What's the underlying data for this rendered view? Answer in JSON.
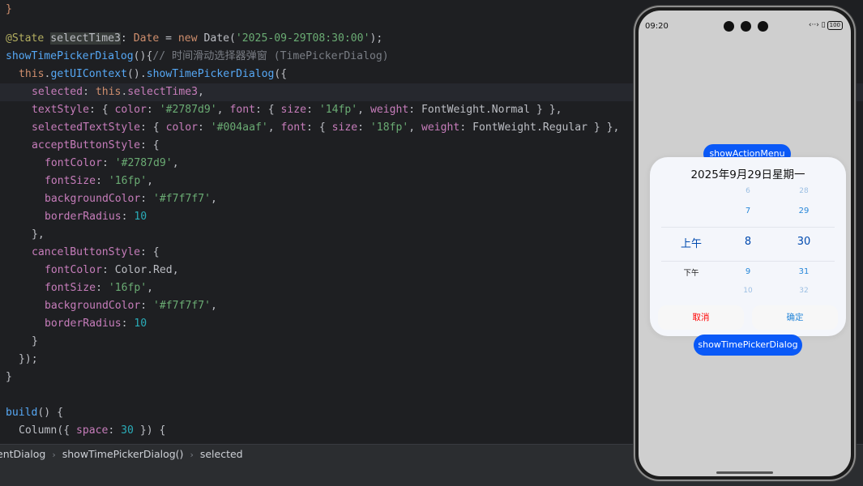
{
  "editor": {
    "line1": {
      "decorator": "@State",
      "name": "selectTime3",
      "colon": ":",
      "type": "Date",
      "eq": "=",
      "kw_new": "new",
      "ctor": "Date",
      "paren_open": "(",
      "arg": "'2025-09-29T08:30:00'",
      "end": ");"
    },
    "line2": {
      "fn": "showTimePickerDialog",
      "sig": "(){",
      "comment": "// 时间滑动选择器弹窗 (TimePickerDialog)"
    },
    "line3": {
      "kw_this": "this",
      "dot1": ".",
      "fn1": "getUIContext",
      "mid": "().",
      "fn2": "showTimePickerDialog",
      "end": "({"
    },
    "line4": {
      "prop": "selected",
      "colon": ": ",
      "kw_this": "this",
      "dot": ".",
      "member": "selectTime3",
      "end": ","
    },
    "line5": {
      "prop": "textStyle",
      "a": ": { ",
      "color_key": "color",
      "b": ": ",
      "color_val": "'#2787d9'",
      "c": ", ",
      "font_key": "font",
      "d": ": { ",
      "size_key": "size",
      "e": ": ",
      "size_val": "'14fp'",
      "f": ", ",
      "weight_key": "weight",
      "g": ": ",
      "weight_val": "FontWeight.Normal",
      "h": " } },"
    },
    "line6": {
      "prop": "selectedTextStyle",
      "a": ": { ",
      "color_key": "color",
      "b": ": ",
      "color_val": "'#004aaf'",
      "c": ", ",
      "font_key": "font",
      "d": ": { ",
      "size_key": "size",
      "e": ": ",
      "size_val": "'18fp'",
      "f": ", ",
      "weight_key": "weight",
      "g": ": ",
      "weight_val": "FontWeight.Regular",
      "h": " } },"
    },
    "line7": {
      "prop": "acceptButtonStyle",
      "end": ": {"
    },
    "line8": {
      "prop": "fontColor",
      "colon": ": ",
      "val": "'#2787d9'",
      "end": ","
    },
    "line9": {
      "prop": "fontSize",
      "colon": ": ",
      "val": "'16fp'",
      "end": ","
    },
    "line10": {
      "prop": "backgroundColor",
      "colon": ": ",
      "val": "'#f7f7f7'",
      "end": ","
    },
    "line11": {
      "prop": "borderRadius",
      "colon": ": ",
      "val": "10"
    },
    "line12": {
      "text": "},"
    },
    "line13": {
      "prop": "cancelButtonStyle",
      "end": ": {"
    },
    "line14": {
      "prop": "fontColor",
      "colon": ": ",
      "val": "Color.Red",
      "end": ","
    },
    "line15": {
      "prop": "fontSize",
      "colon": ": ",
      "val": "'16fp'",
      "end": ","
    },
    "line16": {
      "prop": "backgroundColor",
      "colon": ": ",
      "val": "'#f7f7f7'",
      "end": ","
    },
    "line17": {
      "prop": "borderRadius",
      "colon": ": ",
      "val": "10"
    },
    "line18": {
      "text": "}"
    },
    "line19": {
      "text": "});"
    },
    "line20": {
      "text": "}"
    },
    "line21": {
      "fn": "build",
      "end": "() {"
    },
    "line22": {
      "fn": "Column",
      "a": "({ ",
      "key": "space",
      "b": ": ",
      "val": "30",
      "c": " }) {"
    }
  },
  "breadcrumb": {
    "items": [
      "entDialog",
      "showTimePickerDialog()",
      "selected"
    ],
    "separator": "›"
  },
  "phone": {
    "time": "09:20",
    "status_icons": "‹··› ▯",
    "battery": "100",
    "button_action_menu": "showActionMenu",
    "button_time_picker": "showTimePickerDialog",
    "dialog": {
      "title": "2025年9月29日星期一",
      "ampm": {
        "selected": "上午",
        "next": "下午"
      },
      "hours": {
        "prev2": "6",
        "prev1": "7",
        "selected": "8",
        "next1": "9",
        "next2": "10"
      },
      "minutes": {
        "prev2": "28",
        "prev1": "29",
        "selected": "30",
        "next1": "31",
        "next2": "32"
      },
      "cancel": "取消",
      "accept": "确定"
    }
  },
  "colors": {
    "text": "#2787d9",
    "selected_text": "#004aaf",
    "cancel": "#ff0000",
    "button_bg": "#f7f7f7",
    "pill": "#0a59f7"
  }
}
